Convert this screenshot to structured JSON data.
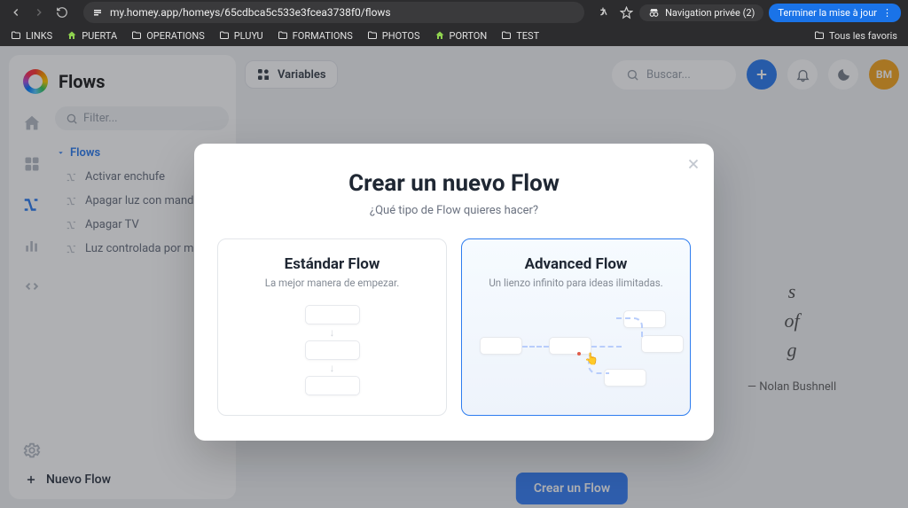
{
  "browser": {
    "url": "my.homey.app/homeys/65cdbca5c533e3fcea3738f0/flows",
    "incognito": "Navigation privée (2)",
    "update": "Terminer la mise à jour",
    "allBookmarks": "Tous les favoris",
    "bookmarks": [
      "LINKS",
      "PUERTA",
      "OPERATIONS",
      "PLUYU",
      "FORMATIONS",
      "PHOTOS",
      "PORTON",
      "TEST"
    ]
  },
  "app": {
    "title": "Flows",
    "filterPlaceholder": "Filter...",
    "searchPlaceholder": "Buscar...",
    "variablesLabel": "Variables",
    "newFlowLabel": "Nuevo Flow",
    "createFlowBtn": "Crear un Flow",
    "avatar": "BM",
    "tree": {
      "root": "Flows",
      "items": [
        "Activar enchufe",
        "Apagar luz con mando",
        "Apagar TV",
        "Luz controlada por mando"
      ]
    },
    "quote": {
      "author": "— Nolan Bushnell"
    }
  },
  "modal": {
    "title": "Crear un nuevo Flow",
    "subtitle": "¿Qué tipo de Flow quieres hacer?",
    "options": {
      "standard": {
        "title": "Estándar Flow",
        "subtitle": "La mejor manera de empezar."
      },
      "advanced": {
        "title": "Advanced Flow",
        "subtitle": "Un lienzo infinito para ideas ilimitadas."
      }
    }
  }
}
